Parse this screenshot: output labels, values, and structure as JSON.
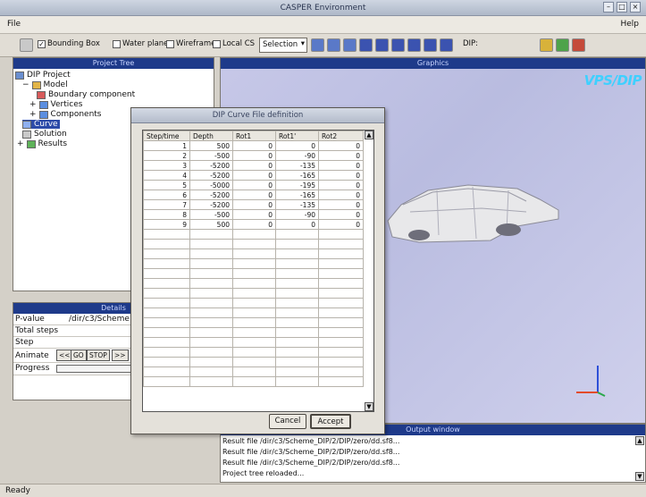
{
  "window": {
    "title": "CASPER Environment"
  },
  "menubar": {
    "file": "File",
    "help": "Help"
  },
  "toolbar": {
    "bounding_box": "Bounding Box",
    "water_plane": "Water plane",
    "wireframe": "Wireframe",
    "local_cs": "Local CS",
    "selection": "Selection",
    "dip": "DIP:"
  },
  "project_tree": {
    "header": "Project Tree",
    "items": [
      "DIP Project",
      "Model",
      "Boundary component",
      "Vertices",
      "Components",
      "Curve",
      "Solution",
      "Results"
    ]
  },
  "graphics": {
    "header": "Graphics",
    "logo": "VPS/DIP"
  },
  "details": {
    "header": "Details",
    "rows": [
      {
        "label": "P-value",
        "value": "/dir/c3/Scheme"
      },
      {
        "label": "Total steps",
        "value": ""
      },
      {
        "label": "Step",
        "value": ""
      },
      {
        "label": "Animate",
        "value": ""
      },
      {
        "label": "Progress",
        "value": ""
      }
    ],
    "animate_buttons": [
      "<<",
      "GO",
      "STOP",
      ">>"
    ]
  },
  "output": {
    "header": "Output window",
    "lines": [
      "Result file /dir/c3/Scheme_DIP/2/DIP/zero/dd.sf8...",
      "Result file /dir/c3/Scheme_DIP/2/DIP/zero/dd.sf8...",
      "Result file /dir/c3/Scheme_DIP/2/DIP/zero/dd.sf8...",
      "Project tree reloaded..."
    ]
  },
  "status": {
    "text": "Ready"
  },
  "dialog": {
    "title": "DIP Curve File definition",
    "columns": [
      "Step/time",
      "Depth",
      "Rot1",
      "Rot1'",
      "Rot2"
    ],
    "rows": [
      [
        "1",
        "500",
        "0",
        "0",
        "0"
      ],
      [
        "2",
        "-500",
        "0",
        "-90",
        "0"
      ],
      [
        "3",
        "-5200",
        "0",
        "-135",
        "0"
      ],
      [
        "4",
        "-5200",
        "0",
        "-165",
        "0"
      ],
      [
        "5",
        "-5000",
        "0",
        "-195",
        "0"
      ],
      [
        "6",
        "-5200",
        "0",
        "-165",
        "0"
      ],
      [
        "7",
        "-5200",
        "0",
        "-135",
        "0"
      ],
      [
        "8",
        "-500",
        "0",
        "-90",
        "0"
      ],
      [
        "9",
        "500",
        "0",
        "0",
        "0"
      ]
    ],
    "cancel": "Cancel",
    "accept": "Accept"
  }
}
